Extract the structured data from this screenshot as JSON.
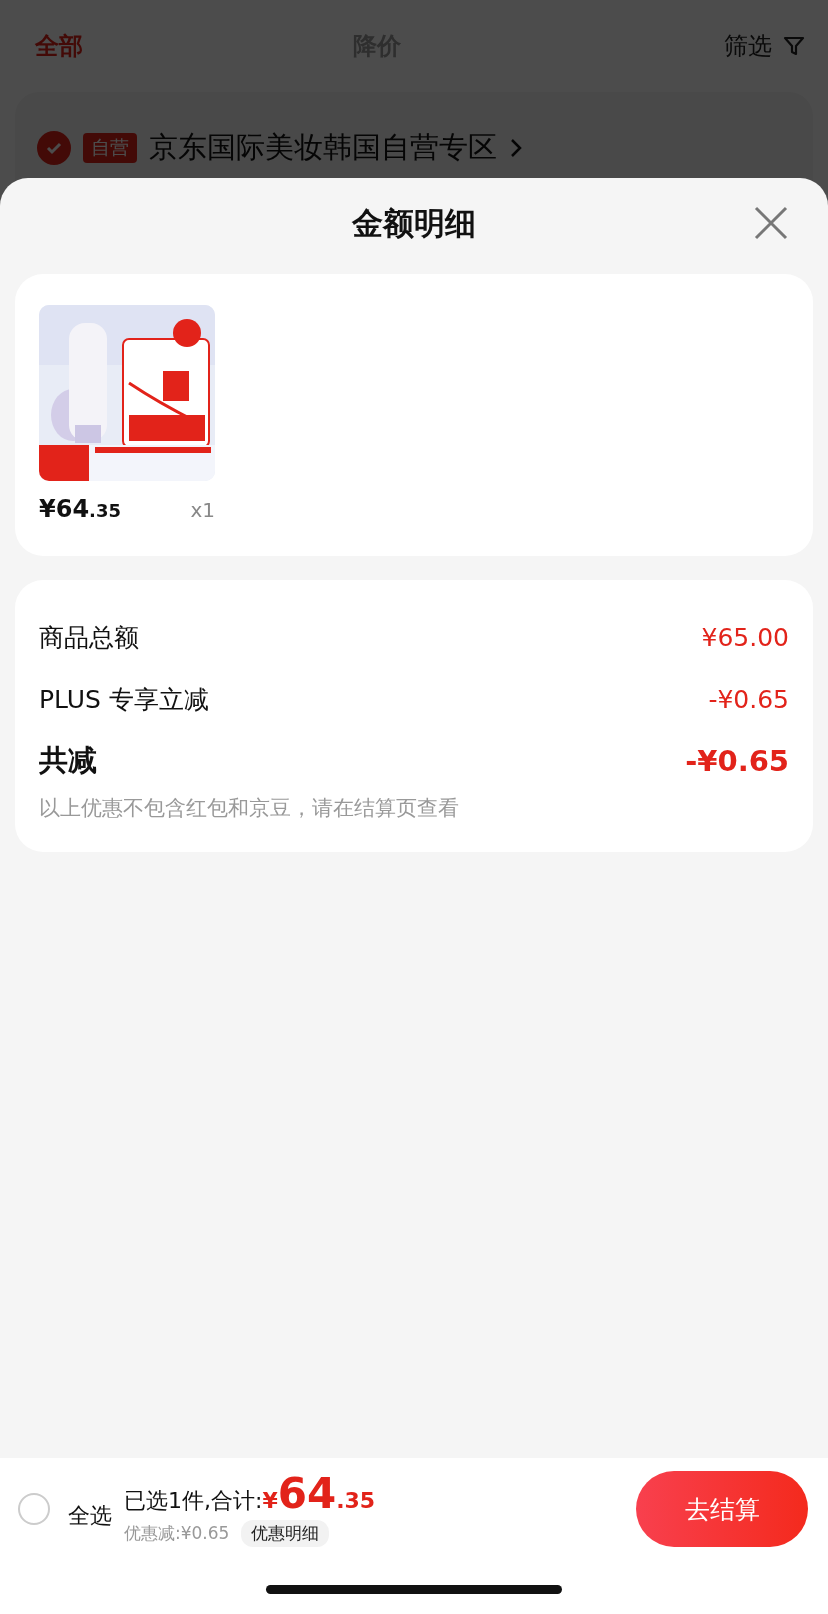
{
  "background": {
    "tabs": [
      {
        "label": "全部",
        "selected": true
      },
      {
        "label": "降价",
        "selected": false
      }
    ],
    "filter": {
      "label": "筛选"
    },
    "store": {
      "checked": true,
      "badge": "自营",
      "name": "京东国际美妆韩国自营专区"
    }
  },
  "sheet": {
    "title": "金额明细",
    "product": {
      "price_main": "¥64",
      "price_decimal": ".35",
      "quantity": "x1"
    },
    "summary": [
      {
        "kind": "normal",
        "label": "商品总额",
        "value": "¥65.00"
      },
      {
        "kind": "normal",
        "label": "PLUS 专享立减",
        "value": "-¥0.65"
      },
      {
        "kind": "total",
        "label": "共减",
        "value": "-¥0.65"
      }
    ],
    "note": "以上优惠不包含红包和京豆，请在结算页查看"
  },
  "bottom_bar": {
    "select_all": {
      "label": "全选",
      "checked": false
    },
    "selected_text": "已选1件,合计:",
    "total": {
      "currency": "¥",
      "integer": "64",
      "decimal": ".35"
    },
    "discount": "优惠减:¥0.65",
    "detail_button": "优惠明细",
    "checkout_button": "去结算"
  }
}
